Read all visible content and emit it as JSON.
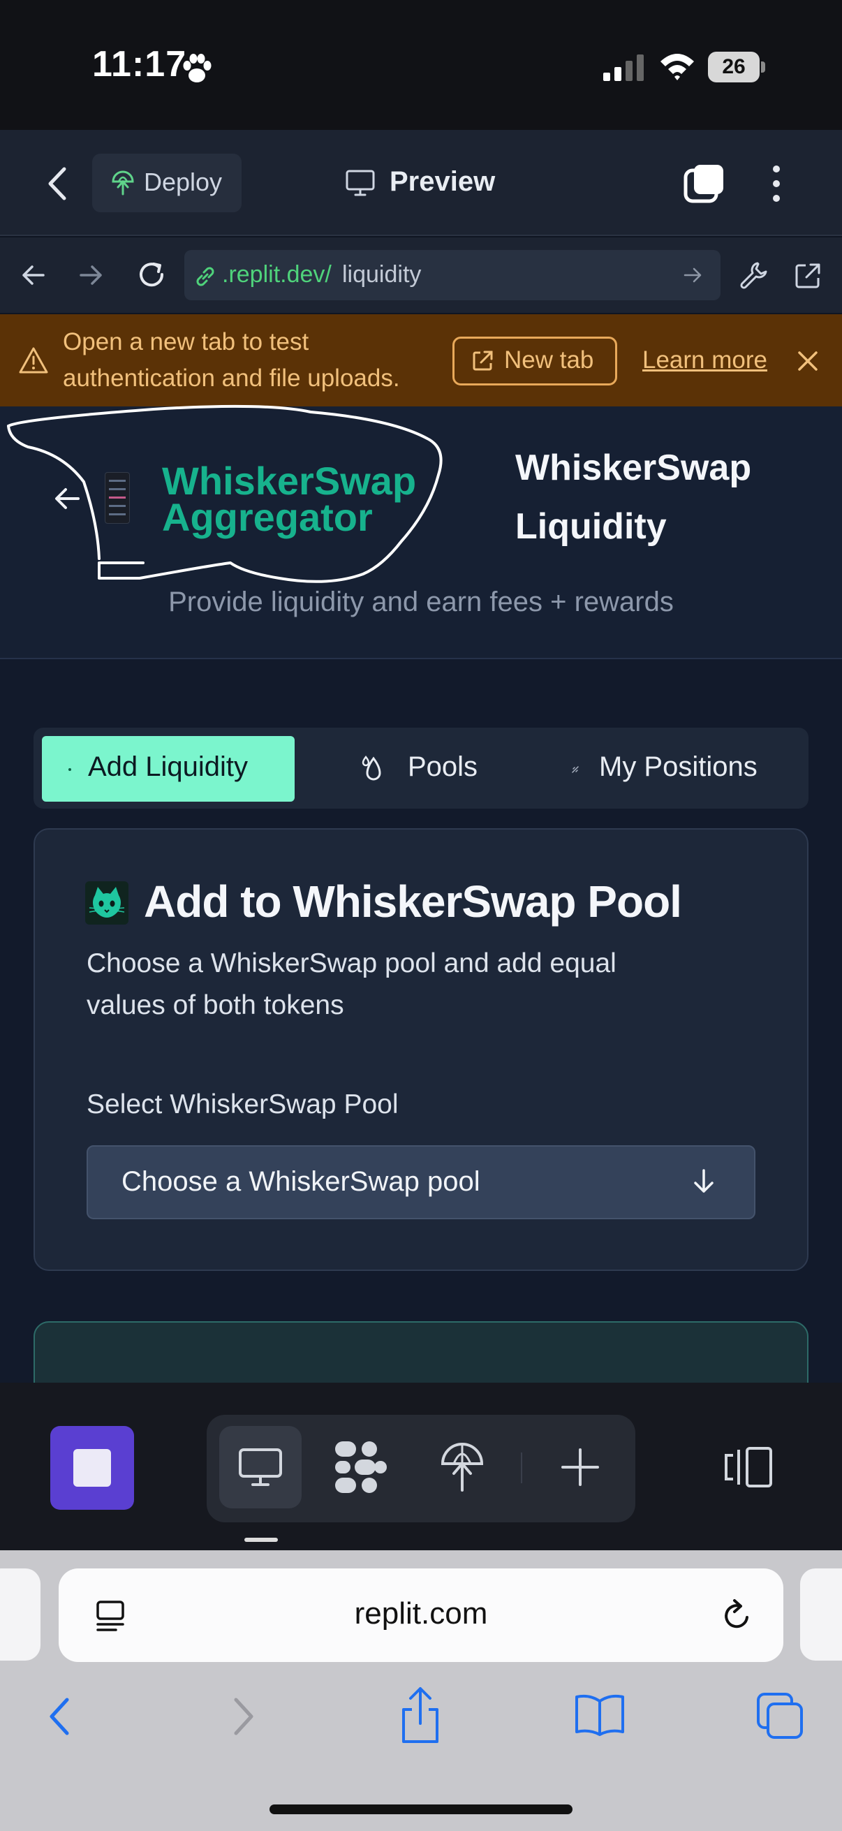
{
  "status_bar": {
    "time": "11:17",
    "battery": "26"
  },
  "replit": {
    "deploy_label": "Deploy",
    "preview_title": "Preview",
    "url_domain": ".replit.dev/",
    "url_path": "liquidity"
  },
  "banner": {
    "line_1": "Open a new tab to test",
    "line_2": "authentication and file uploads.",
    "new_tab_label": "New tab",
    "learn_more_label": "Learn more"
  },
  "app": {
    "brand_line_1": "WhiskerSwap",
    "brand_line_2": "Aggregator",
    "title_line_1": "WhiskerSwap",
    "title_line_2": "Liquidity",
    "subtitle": "Provide liquidity and earn fees + rewards",
    "tabs": [
      {
        "label": "Add Liquidity",
        "active": true
      },
      {
        "label": "Pools",
        "active": false
      },
      {
        "label": "My Positions",
        "active": false
      }
    ],
    "card": {
      "title": "Add to WhiskerSwap Pool",
      "desc_line_1": "Choose a WhiskerSwap pool and add equal",
      "desc_line_2": "values of both tokens",
      "select_label": "Select WhiskerSwap Pool",
      "select_value": "Choose a WhiskerSwap pool"
    }
  },
  "safari": {
    "domain": "replit.com"
  },
  "colors": {
    "accent_mint": "#7bf5cd",
    "brand_teal": "#17b28d",
    "banner_bg": "#5b3206",
    "banner_text": "#f1c07c",
    "stop_purple": "#5a3fd1"
  }
}
